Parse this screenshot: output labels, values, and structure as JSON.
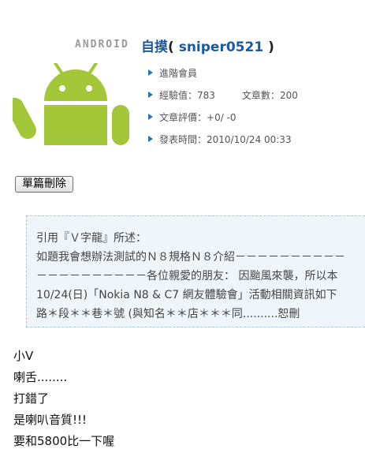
{
  "header": {
    "wordmark": "ANDROID",
    "poster_name": "自摸",
    "poster_open": "(",
    "poster_id": "sniper0521",
    "poster_close": ")"
  },
  "info": {
    "rank": "進階會員",
    "exp_label": "經驗值：",
    "exp_value": "783",
    "posts_label": "文章數：",
    "posts_value": "200",
    "rating_label": "文章評價：",
    "rating_value": "+0/ -0",
    "time_label": "發表時間：",
    "time_value": "2010/10/24 00:33"
  },
  "actions": {
    "delete_label": "單篇刪除"
  },
  "quote": {
    "line1": "引用『Ｖ字龍』所述：",
    "line2": "如題我會想辦法測試的Ｎ８規格Ｎ８介紹－－－－－－－－－－",
    "line3": "－－－－－－－－－－各位親愛的朋友： 因颱風來襲，所以本",
    "line4": "10/24(日)「Nokia N8 & C7 網友體驗會」活動相關資訊如下",
    "line5": "路＊段＊＊巷＊號 (與知名＊＊店＊＊＊同..........恕刪"
  },
  "body": {
    "lines": [
      "小V",
      "喇舌........",
      "打錯了",
      "是喇叭音質!!!",
      "要和5800比一下喔"
    ]
  },
  "colors": {
    "android_green": "#a4c639",
    "poster_blue": "#1c5a9c",
    "bullet_blue": "#2d74b5",
    "quote_bg": "#eef6fc"
  }
}
